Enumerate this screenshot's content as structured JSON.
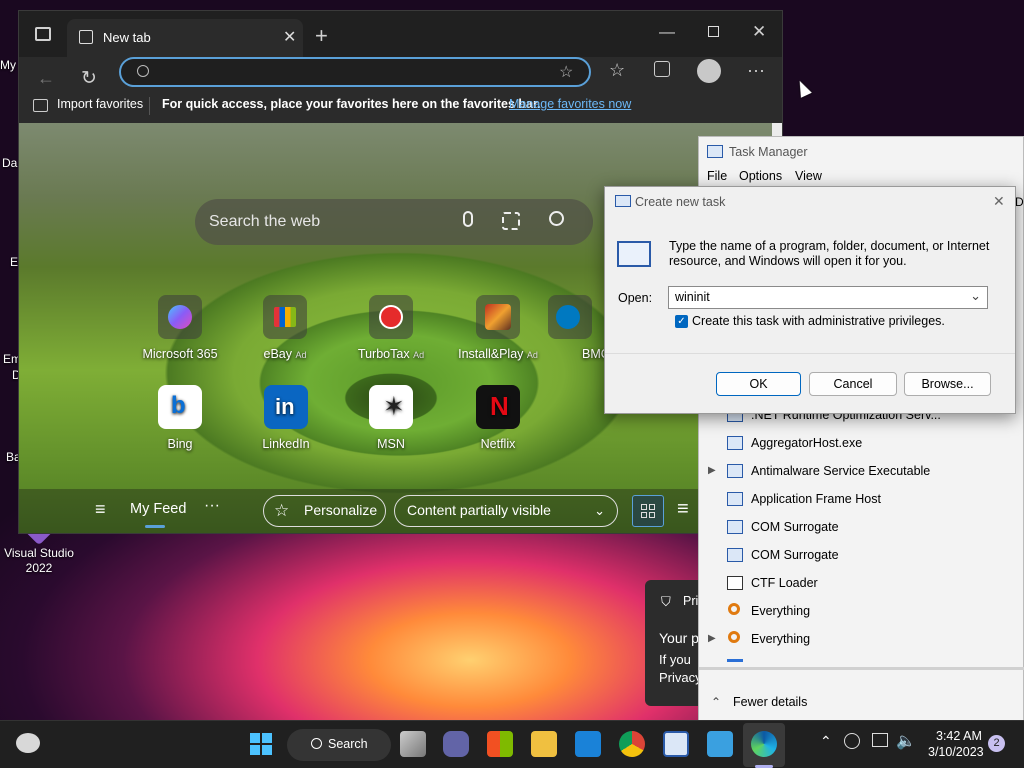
{
  "desktop": {
    "icons": [
      {
        "label": "My"
      },
      {
        "label": "Da"
      },
      {
        "label": "E"
      },
      {
        "label": "Em"
      },
      {
        "label": "D"
      },
      {
        "label": "Ba"
      },
      {
        "label": "Visual Studio 2022"
      }
    ]
  },
  "edge": {
    "tab_title": "New tab",
    "import_favorites": "Import favorites",
    "favbar_text": "For quick access, place your favorites here on the favorites bar.",
    "manage_favorites": "Manage favorites now",
    "search_placeholder": "Search the web",
    "tiles_row1": [
      {
        "label": "Microsoft 365",
        "ad": ""
      },
      {
        "label": "eBay",
        "ad": "Ad"
      },
      {
        "label": "TurboTax",
        "ad": "Ad"
      },
      {
        "label": "Install&Play",
        "ad": "Ad"
      },
      {
        "label": "BMO",
        "ad": ""
      }
    ],
    "tiles_row2": [
      {
        "label": "Bing"
      },
      {
        "label": "LinkedIn"
      },
      {
        "label": "MSN"
      },
      {
        "label": "Netflix"
      }
    ],
    "feed_label": "My Feed",
    "personalize": "Personalize",
    "content_visibility": "Content partially visible"
  },
  "task_manager": {
    "title": "Task Manager",
    "menu": [
      "File",
      "Options",
      "View"
    ],
    "partial_header": "De",
    "processes": [
      ".NET Runtime Optimization Serv...",
      "AggregatorHost.exe",
      "Antimalware Service Executable",
      "Application Frame Host",
      "COM Surrogate",
      "COM Surrogate",
      "CTF Loader",
      "Everything",
      "Everything"
    ],
    "fewer_details": "Fewer details"
  },
  "dialog": {
    "title": "Create new task",
    "description": "Type the name of a program, folder, document, or Internet resource, and Windows will open it for you.",
    "open_label": "Open:",
    "open_value": "wininit",
    "admin_label": "Create this task with administrative privileges.",
    "admin_checked": true,
    "ok": "OK",
    "cancel": "Cancel",
    "browse": "Browse..."
  },
  "notification": {
    "title": "Pri",
    "line1": "Your p",
    "line2": "If you",
    "line3": "Privacy"
  },
  "taskbar": {
    "search_label": "Search",
    "time": "3:42 AM",
    "date": "3/10/2023",
    "badge": "2"
  },
  "colors": {
    "accent": "#5aa0d8",
    "edge_bg": "#202020",
    "link": "#6cb8f6"
  }
}
